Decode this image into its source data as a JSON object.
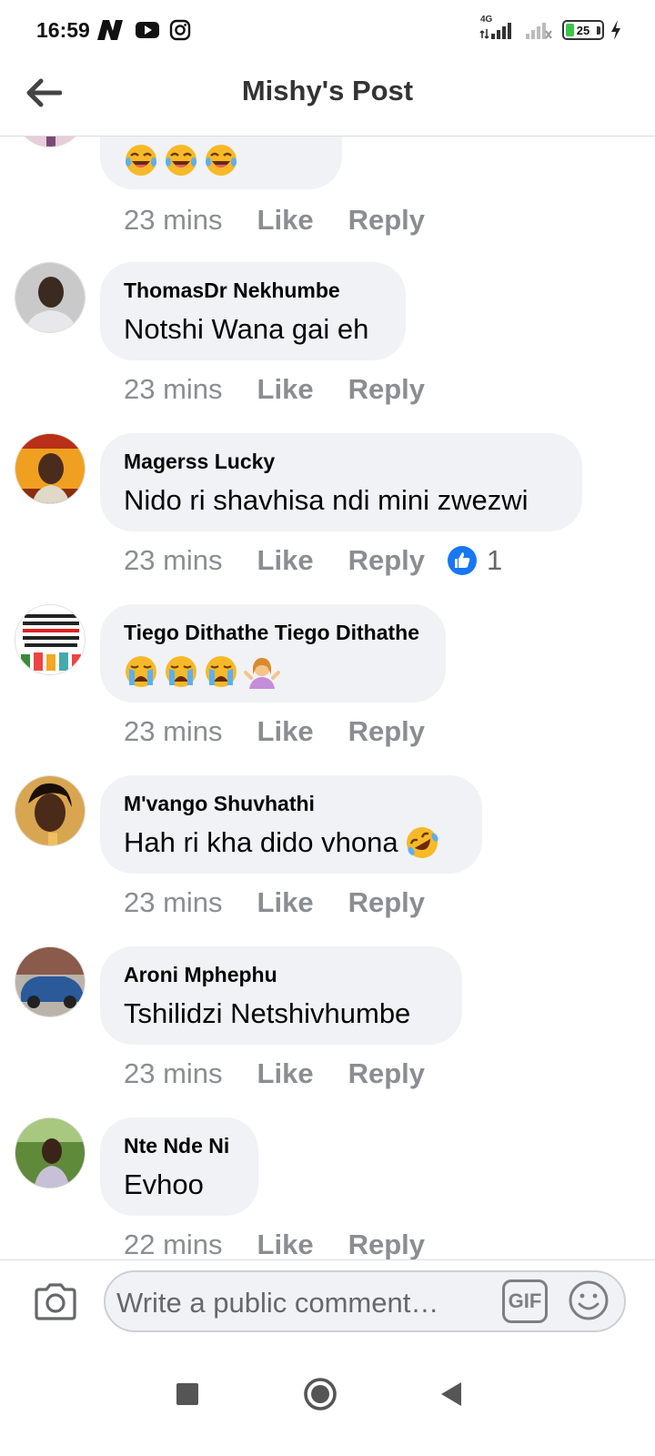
{
  "status_bar": {
    "time": "16:59",
    "network": "4G",
    "battery": "25",
    "battery_level": 0.25
  },
  "header": {
    "title": "Mishy's Post",
    "back_icon": "arrow-left-icon"
  },
  "comments": [
    {
      "author": "",
      "text": "",
      "emojis": [
        "laughing-tears",
        "laughing-tears",
        "laughing-tears"
      ],
      "time": "23 mins",
      "like": "Like",
      "reply": "Reply"
    },
    {
      "author": "ThomasDr Nekhumbe",
      "text": "Notshi Wana gai eh",
      "time": "23 mins",
      "like": "Like",
      "reply": "Reply"
    },
    {
      "author": "Magerss Lucky",
      "text": "Nido ri shavhisa ndi mini zwezwi",
      "time": "23 mins",
      "like": "Like",
      "reply": "Reply",
      "reaction_count": "1"
    },
    {
      "author": "Tiego Dithathe Tiego Dithathe",
      "text": "",
      "emojis": [
        "crying",
        "crying",
        "crying",
        "woman-shrugging"
      ],
      "time": "23 mins",
      "like": "Like",
      "reply": "Reply"
    },
    {
      "author": "M'vango Shuvhathi",
      "text": "Hah ri kha dido vhona",
      "emoji_suffix": "rolling-laughing",
      "time": "23 mins",
      "like": "Like",
      "reply": "Reply"
    },
    {
      "author": "Aroni Mphephu",
      "text": "Tshilidzi Netshivhumbe",
      "time": "23 mins",
      "like": "Like",
      "reply": "Reply"
    },
    {
      "author": "Nte Nde Ni",
      "text": "Evhoo",
      "time": "22 mins",
      "like": "Like",
      "reply": "Reply"
    }
  ],
  "composer": {
    "placeholder": "Write a public comment…",
    "gif_label": "GIF"
  },
  "colors": {
    "bubble_bg": "#f0f2f5",
    "meta_text": "#8a8d91",
    "like_blue": "#1877f2",
    "battery_green": "#3cc54a"
  }
}
